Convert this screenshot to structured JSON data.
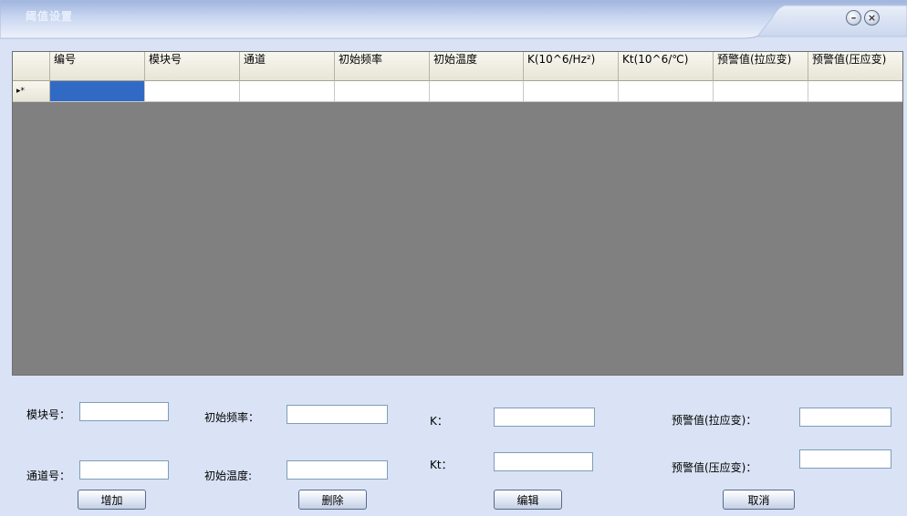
{
  "window": {
    "title": "阈值设置",
    "minimize_glyph": "–",
    "close_glyph": "×"
  },
  "grid": {
    "columns": [
      "编号",
      "模块号",
      "通道",
      "初始频率",
      "初始温度",
      "K(10^6/Hz²)",
      "Kt(10^6/℃)",
      "预警值(拉应变)",
      "预警值(压应变)"
    ],
    "new_row_marker": "▸*"
  },
  "form": {
    "module_label": "模块号：",
    "channel_label": "通道号：",
    "init_freq_label": "初始频率：",
    "init_temp_label": "初始温度:",
    "k_label": "K：",
    "kt_label": "Kt：",
    "warn_tension_label": "预警值(拉应变)：",
    "warn_compress_label": "预警值(压应变)：",
    "module_value": "",
    "channel_value": "",
    "init_freq_value": "",
    "init_temp_value": "",
    "k_value": "",
    "kt_value": "",
    "warn_tension_value": "",
    "warn_compress_value": ""
  },
  "buttons": {
    "add": "增加",
    "delete": "删除",
    "edit": "编辑",
    "cancel": "取消"
  },
  "icons": {
    "minimize": "minimize-icon",
    "close": "close-icon"
  }
}
